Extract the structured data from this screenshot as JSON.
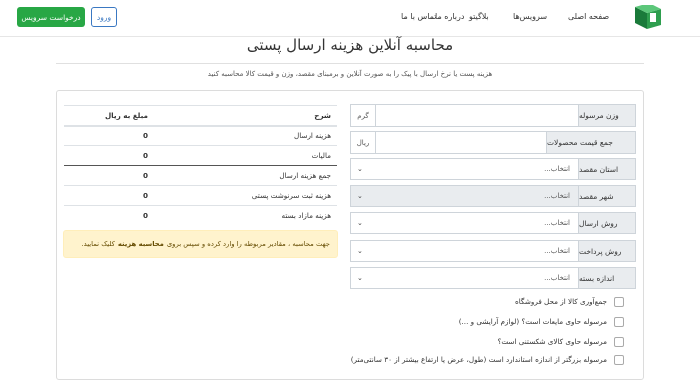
{
  "header": {
    "logo_icon": "truck-logo-icon",
    "menu": [
      {
        "label": "صفحه اصلی"
      },
      {
        "label": "سرویس‌ها"
      },
      {
        "label": "بلاگیتو"
      },
      {
        "label": "درباره ما"
      },
      {
        "label": "تماس با ما"
      }
    ],
    "request_service_label": "درخواست سرویس",
    "login_label": "ورود"
  },
  "page": {
    "title": "محاسبه آنلاین هزینه ارسال پستی",
    "subtitle": "هزینه پست یا نرخ ارسال با پیک را به صورت آنلاین و برمبنای مقصد، وزن و قیمت کالا محاسبه کنید"
  },
  "form": {
    "weight_label": "وزن مرسوله",
    "weight_unit": "گرم",
    "weight_value": "",
    "price_label": "جمع قیمت محصولات",
    "price_unit": "ریال",
    "price_value": "",
    "origin_label": "استان مقصد",
    "origin_value": "انتخاب...",
    "city_label": "شهر مقصد",
    "city_value": "انتخاب...",
    "method_label": "روش ارسال",
    "method_value": "انتخاب...",
    "payment_label": "روش پرداخت",
    "payment_value": "انتخاب...",
    "size_label": "اندازه بسته",
    "size_value": "انتخاب...",
    "checks": [
      {
        "label": "جمع‌آوری کالا از محل فروشگاه",
        "checked": false
      },
      {
        "label": "مرسوله حاوی مایعات است؟ (لوازم آرایشی و ...)",
        "checked": false
      },
      {
        "label": "مرسوله حاوی کالای شکستنی است؟",
        "checked": false
      },
      {
        "label": "مرسوله بزرگتر از اندازه استاندارد است (طول، عرض یا ارتفاع بیشتر از ۳۰ سانتی‌متر)",
        "checked": false
      }
    ]
  },
  "summary": {
    "col_desc": "شرح",
    "col_amount": "مبلغ به ریال",
    "rows": [
      {
        "label": "هزینه ارسال",
        "value": "0"
      },
      {
        "label": "مالیات",
        "value": "0"
      },
      {
        "label": "جمع هزینه ارسال",
        "value": "0"
      },
      {
        "label": "هزینه ثبت سرنوشت پستی",
        "value": "0"
      },
      {
        "label": "هزینه مازاد بسته",
        "value": "0"
      }
    ],
    "note_prefix": "جهت محاسبه ، مقادیر مربوطه را وارد کرده و سپس بروی",
    "note_bold": "محاسبه هزینه",
    "note_suffix": "کلیک نمایید."
  },
  "colors": {
    "primary_green": "#28a745",
    "login_blue": "#3a78c2",
    "alert_bg": "#fff3cd"
  }
}
